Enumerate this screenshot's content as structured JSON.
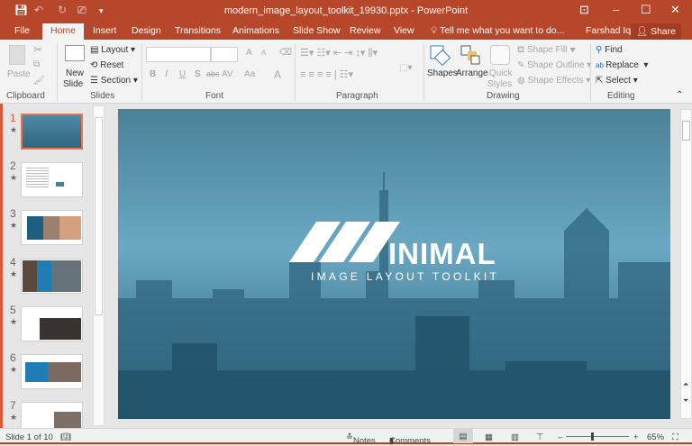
{
  "app": {
    "title": "modern_image_layout_toolkit_19930.pptx - PowerPoint",
    "user": "Farshad Iqbal",
    "share": "Share",
    "tell_me": "Tell me what you want to do..."
  },
  "tabs": [
    "File",
    "Home",
    "Insert",
    "Design",
    "Transitions",
    "Animations",
    "Slide Show",
    "Review",
    "View"
  ],
  "ribbon": {
    "clipboard": {
      "paste": "Paste",
      "label": "Clipboard"
    },
    "slides": {
      "new_slide": "New",
      "new_slide2": "Slide",
      "layout": "Layout",
      "reset": "Reset",
      "section": "Section",
      "label": "Slides"
    },
    "font": {
      "bold": "B",
      "italic": "I",
      "underline": "U",
      "shadow": "S",
      "strike": "abc",
      "spacing": "AV",
      "case": "Aa",
      "color": "A",
      "grow": "A",
      "shrink": "A",
      "label": "Font"
    },
    "paragraph": {
      "label": "Paragraph"
    },
    "drawing": {
      "shapes": "Shapes",
      "arrange": "Arrange",
      "quick_styles": "Quick",
      "quick_styles2": "Styles",
      "shape_fill": "Shape Fill",
      "shape_outline": "Shape Outline",
      "shape_effects": "Shape Effects",
      "label": "Drawing"
    },
    "editing": {
      "find": "Find",
      "replace": "Replace",
      "select": "Select",
      "label": "Editing"
    }
  },
  "thumbnails": [
    {
      "n": "1"
    },
    {
      "n": "2"
    },
    {
      "n": "3"
    },
    {
      "n": "4"
    },
    {
      "n": "5"
    },
    {
      "n": "6"
    },
    {
      "n": "7"
    }
  ],
  "slide": {
    "logo_text": "INIMAL",
    "subtitle": "IMAGE LAYOUT TOOLKIT"
  },
  "status": {
    "slide": "Slide 1 of 10",
    "notes": "Notes",
    "comments": "Comments",
    "zoom": "65%",
    "zoom_fraction": 0.4
  },
  "colors": {
    "accent": "#b7472a",
    "selected_thumb": "#f0714b"
  }
}
